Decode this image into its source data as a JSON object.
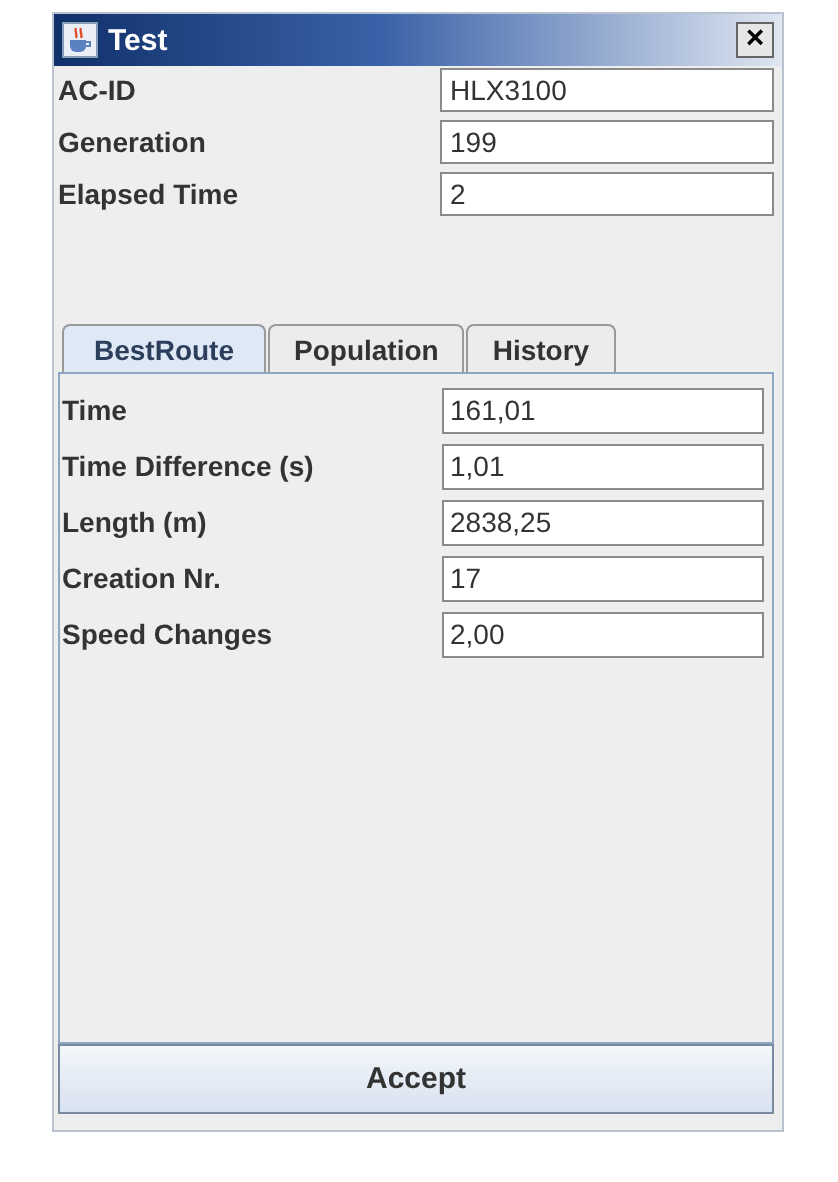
{
  "window": {
    "title": "Test",
    "close": "×"
  },
  "fields": [
    {
      "label": "AC-ID",
      "value": "HLX3100"
    },
    {
      "label": "Generation",
      "value": "199"
    },
    {
      "label": "Elapsed Time",
      "value": "2"
    }
  ],
  "tabs": [
    {
      "label": "BestRoute",
      "selected": true
    },
    {
      "label": "Population",
      "selected": false
    },
    {
      "label": "History",
      "selected": false
    }
  ],
  "tab_fields": [
    {
      "label": "Time",
      "value": "161,01"
    },
    {
      "label": "Time Difference (s)",
      "value": "1,01"
    },
    {
      "label": "Length (m)",
      "value": "2838,25"
    },
    {
      "label": "Creation Nr.",
      "value": "17"
    },
    {
      "label": "Speed Changes",
      "value": "2,00"
    }
  ],
  "button": "Accept"
}
